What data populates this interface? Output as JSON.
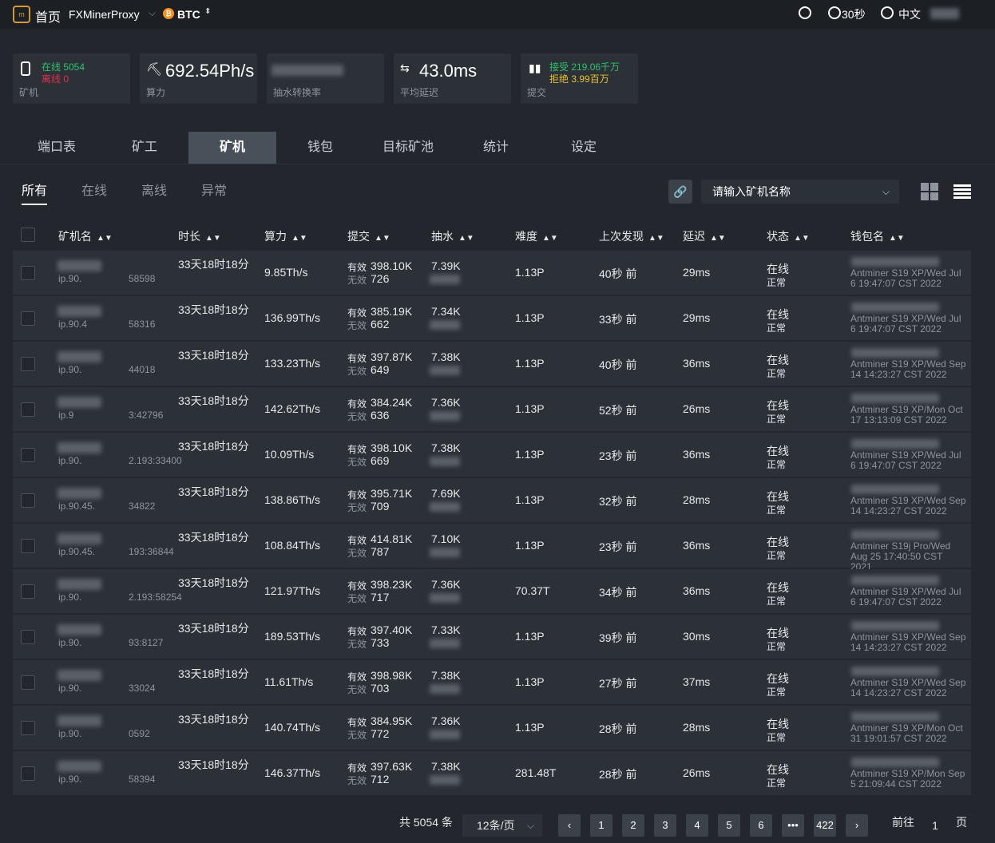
{
  "topbar": {
    "logo_icon": "pool-logo-icon",
    "home": "首页",
    "app": "FXMinerProxy",
    "coin": "BTC",
    "refresh_icon": "refresh-icon",
    "timer_icon": "timer-icon",
    "timer": "30秒",
    "globe_icon": "globe-icon",
    "lang": "中文"
  },
  "stats": {
    "online": "在线 5054",
    "offline": "离线 0",
    "miner_label": "矿机",
    "hashrate": "692.54Ph/s",
    "hashrate_label": "算力",
    "fee_label": "抽水转换率",
    "latency": "43.0ms",
    "latency_label": "平均延迟",
    "accepted": "接受 219.06千万",
    "rejected": "拒绝 3.99百万",
    "submit_label": "提交"
  },
  "tabs": [
    "端口表",
    "矿工",
    "矿机",
    "钱包",
    "目标矿池",
    "统计",
    "设定"
  ],
  "subtabs": [
    "所有",
    "在线",
    "离线",
    "异常"
  ],
  "search": {
    "placeholder": "请输入矿机名称"
  },
  "table": {
    "headers": [
      "矿机名",
      "时长",
      "算力",
      "提交",
      "抽水",
      "难度",
      "上次发现",
      "延迟",
      "状态",
      "钱包名"
    ],
    "valid_label": "有效",
    "invalid_label": "无效",
    "status_online": "在线",
    "status_normal": "正常",
    "rows": [
      {
        "name": "ip.90.",
        "port": "58598",
        "uptime": "33天18时18分",
        "hashrate": "9.85Th/s",
        "valid": "398.10K",
        "invalid": "726",
        "fee": "7.39K",
        "diff": "1.13P",
        "last": "40秒 前",
        "latency": "29ms",
        "wallet": "Antminer S19 XP/Wed Jul 6 19:47:07 CST 2022"
      },
      {
        "name": "ip.90.4",
        "port": "58316",
        "uptime": "33天18时18分",
        "hashrate": "136.99Th/s",
        "valid": "385.19K",
        "invalid": "662",
        "fee": "7.34K",
        "diff": "1.13P",
        "last": "33秒 前",
        "latency": "29ms",
        "wallet": "Antminer S19 XP/Wed Jul 6 19:47:07 CST 2022"
      },
      {
        "name": "ip.90.",
        "port": "44018",
        "uptime": "33天18时18分",
        "hashrate": "133.23Th/s",
        "valid": "397.87K",
        "invalid": "649",
        "fee": "7.38K",
        "diff": "1.13P",
        "last": "40秒 前",
        "latency": "36ms",
        "wallet": "Antminer S19 XP/Wed Sep 14 14:23:27 CST 2022"
      },
      {
        "name": "ip.9",
        "port": "3:42796",
        "uptime": "33天18时18分",
        "hashrate": "142.62Th/s",
        "valid": "384.24K",
        "invalid": "636",
        "fee": "7.36K",
        "diff": "1.13P",
        "last": "52秒 前",
        "latency": "26ms",
        "wallet": "Antminer S19 XP/Mon Oct 17 13:13:09 CST 2022"
      },
      {
        "name": "ip.90.",
        "port": "2.193:33400",
        "uptime": "33天18时18分",
        "hashrate": "10.09Th/s",
        "valid": "398.10K",
        "invalid": "669",
        "fee": "7.38K",
        "diff": "1.13P",
        "last": "23秒 前",
        "latency": "36ms",
        "wallet": "Antminer S19 XP/Wed Jul 6 19:47:07 CST 2022"
      },
      {
        "name": "ip.90.45.",
        "port": "34822",
        "uptime": "33天18时18分",
        "hashrate": "138.86Th/s",
        "valid": "395.71K",
        "invalid": "709",
        "fee": "7.69K",
        "diff": "1.13P",
        "last": "32秒 前",
        "latency": "28ms",
        "wallet": "Antminer S19 XP/Wed Sep 14 14:23:27 CST 2022"
      },
      {
        "name": "ip.90.45.",
        "port": "193:36844",
        "uptime": "33天18时18分",
        "hashrate": "108.84Th/s",
        "valid": "414.81K",
        "invalid": "787",
        "fee": "7.10K",
        "diff": "1.13P",
        "last": "23秒 前",
        "latency": "36ms",
        "wallet": "Antminer S19j Pro/Wed Aug 25 17:40:50 CST 2021"
      },
      {
        "name": "ip.90.",
        "port": "2.193:58254",
        "uptime": "33天18时18分",
        "hashrate": "121.97Th/s",
        "valid": "398.23K",
        "invalid": "717",
        "fee": "7.36K",
        "diff": "70.37T",
        "last": "34秒 前",
        "latency": "36ms",
        "wallet": "Antminer S19 XP/Wed Jul 6 19:47:07 CST 2022"
      },
      {
        "name": "ip.90.",
        "port": "93:8127",
        "uptime": "33天18时18分",
        "hashrate": "189.53Th/s",
        "valid": "397.40K",
        "invalid": "733",
        "fee": "7.33K",
        "diff": "1.13P",
        "last": "39秒 前",
        "latency": "30ms",
        "wallet": "Antminer S19 XP/Wed Sep 14 14:23:27 CST 2022"
      },
      {
        "name": "ip.90.",
        "port": "33024",
        "uptime": "33天18时18分",
        "hashrate": "11.61Th/s",
        "valid": "398.98K",
        "invalid": "703",
        "fee": "7.38K",
        "diff": "1.13P",
        "last": "27秒 前",
        "latency": "37ms",
        "wallet": "Antminer S19 XP/Wed Sep 14 14:23:27 CST 2022"
      },
      {
        "name": "ip.90.",
        "port": "0592",
        "uptime": "33天18时18分",
        "hashrate": "140.74Th/s",
        "valid": "384.95K",
        "invalid": "772",
        "fee": "7.36K",
        "diff": "1.13P",
        "last": "28秒 前",
        "latency": "28ms",
        "wallet": "Antminer S19 XP/Mon Oct 31 19:01:57 CST 2022"
      },
      {
        "name": "ip.90.",
        "port": "58394",
        "uptime": "33天18时18分",
        "hashrate": "146.37Th/s",
        "valid": "397.63K",
        "invalid": "712",
        "fee": "7.38K",
        "diff": "281.48T",
        "last": "28秒 前",
        "latency": "26ms",
        "wallet": "Antminer S19 XP/Mon Sep 5 21:09:44 CST 2022"
      }
    ]
  },
  "pagination": {
    "total": "共 5054 条",
    "per_page": "12条/页",
    "pages": [
      "1",
      "2",
      "3",
      "4",
      "5",
      "6",
      "•••",
      "422"
    ],
    "goto": "前往",
    "current": "1",
    "unit": "页"
  }
}
